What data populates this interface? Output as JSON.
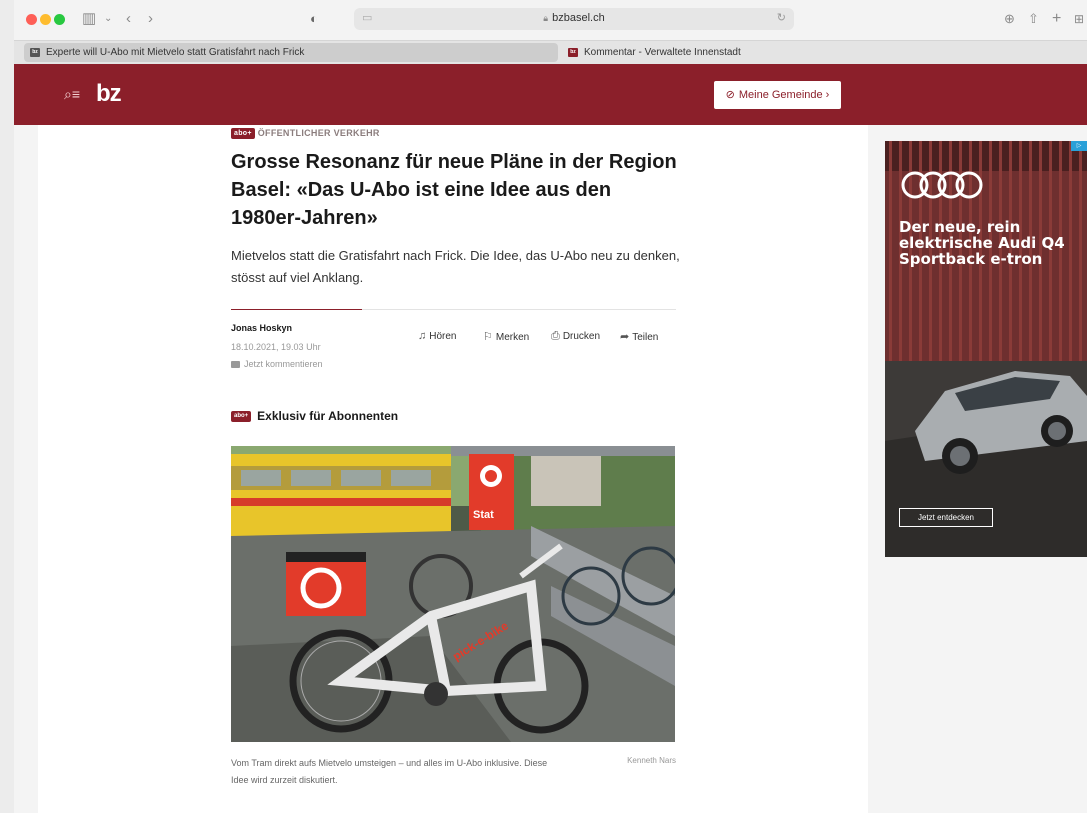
{
  "browser": {
    "url": "bzbasel.ch",
    "tabs": [
      {
        "label": "Experte will U-Abo mit Mietvelo statt Gratisfahrt nach Frick",
        "active": true
      },
      {
        "label": "Kommentar - Verwaltete Innenstadt",
        "active": false
      }
    ]
  },
  "site": {
    "logo": "bz",
    "gemeinde_button": "Meine Gemeinde ›",
    "brand_color": "#8b1f2a"
  },
  "article": {
    "abo_badge": "abo+",
    "kicker": "ÖFFENTLICHER VERKEHR",
    "headline": "Grosse Resonanz für neue Pläne in der Region Basel: «Das U-Abo ist eine Idee aus den 1980er-Jahren»",
    "lead": "Mietvelos statt die Gratisfahrt nach Frick. Die Idee, das U-Abo neu zu denken, stösst auf viel Anklang.",
    "author": "Jonas Hoskyn",
    "date": "18.10.2021, 19.03 Uhr",
    "comment_link": "Jetzt kommentieren",
    "actions": {
      "listen": "Hören",
      "bookmark": "Merken",
      "print": "Drucken",
      "share": "Teilen"
    },
    "exclusive": "Exklusiv für Abonnenten",
    "photo": {
      "sign_text": "Stat",
      "bike_brand": "pick-e-bike",
      "caption": "Vom Tram direkt aufs Mietvelo umsteigen – und alles im U-Abo inklusive. Diese Idee wird zurzeit diskutiert.",
      "credit": "Kenneth Nars"
    }
  },
  "ad": {
    "headline": "Der neue, rein elektrische Audi Q4 Sportback e-tron",
    "button": "Jetzt entdecken"
  }
}
